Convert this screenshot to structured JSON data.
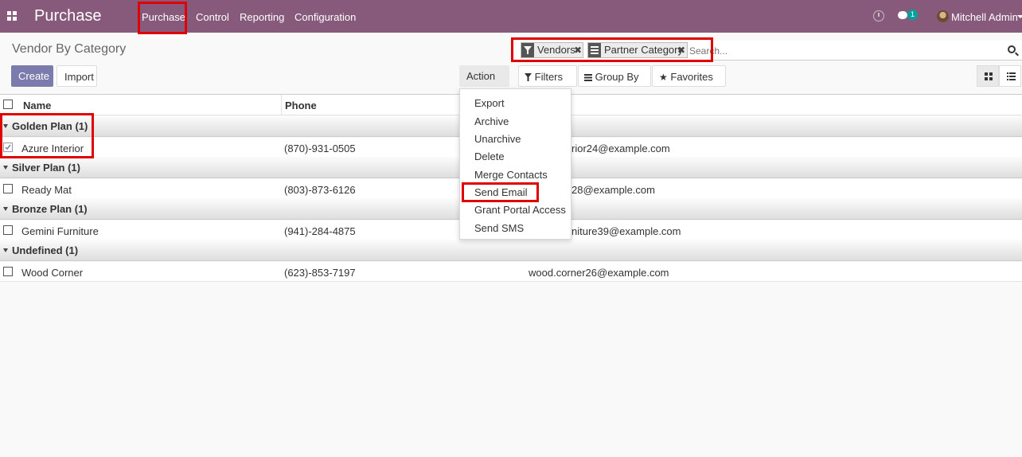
{
  "navbar": {
    "app_name": "Purchase",
    "menus": [
      "Purchase",
      "Control",
      "Reporting",
      "Configuration"
    ],
    "notification_count": "1",
    "user_name": "Mitchell Admin"
  },
  "control_panel": {
    "title": "Vendor By Category",
    "create_label": "Create",
    "import_label": "Import",
    "action_label": "Action",
    "filters_label": "Filters",
    "groupby_label": "Group By",
    "favorites_label": "Favorites",
    "facets": [
      {
        "icon": "filter-icon",
        "label": "Vendors"
      },
      {
        "icon": "list-icon",
        "label": "Partner Category"
      }
    ],
    "search_placeholder": "Search..."
  },
  "list": {
    "columns": [
      "Name",
      "Phone"
    ],
    "groups": [
      {
        "label": "Golden Plan (1)",
        "rows": [
          {
            "name": "Azure Interior",
            "phone": "(870)-931-0505",
            "email": "azure.Interior24@example.com",
            "selected": true
          }
        ]
      },
      {
        "label": "Silver Plan (1)",
        "rows": [
          {
            "name": "Ready Mat",
            "phone": "(803)-873-6126",
            "email": "ready.mat28@example.com",
            "selected": false
          }
        ]
      },
      {
        "label": "Bronze Plan (1)",
        "rows": [
          {
            "name": "Gemini Furniture",
            "phone": "(941)-284-4875",
            "email": "gemini.furniture39@example.com",
            "selected": false
          }
        ]
      },
      {
        "label": "Undefined (1)",
        "rows": [
          {
            "name": "Wood Corner",
            "phone": "(623)-853-7197",
            "email": "wood.corner26@example.com",
            "selected": false
          }
        ]
      }
    ]
  },
  "visible_email_fragments": [
    "rior24@example.com",
    "28@example.com",
    "niture39@example.com",
    "wood.corner26@example.com"
  ],
  "action_menu": [
    "Export",
    "Archive",
    "Unarchive",
    "Delete",
    "Merge Contacts",
    "Send Email",
    "Grant Portal Access",
    "Send SMS"
  ],
  "colors": {
    "navbar": "#875a7b",
    "primary_button": "#7c7bad",
    "highlight": "#e00000",
    "badge": "#00a09d"
  }
}
